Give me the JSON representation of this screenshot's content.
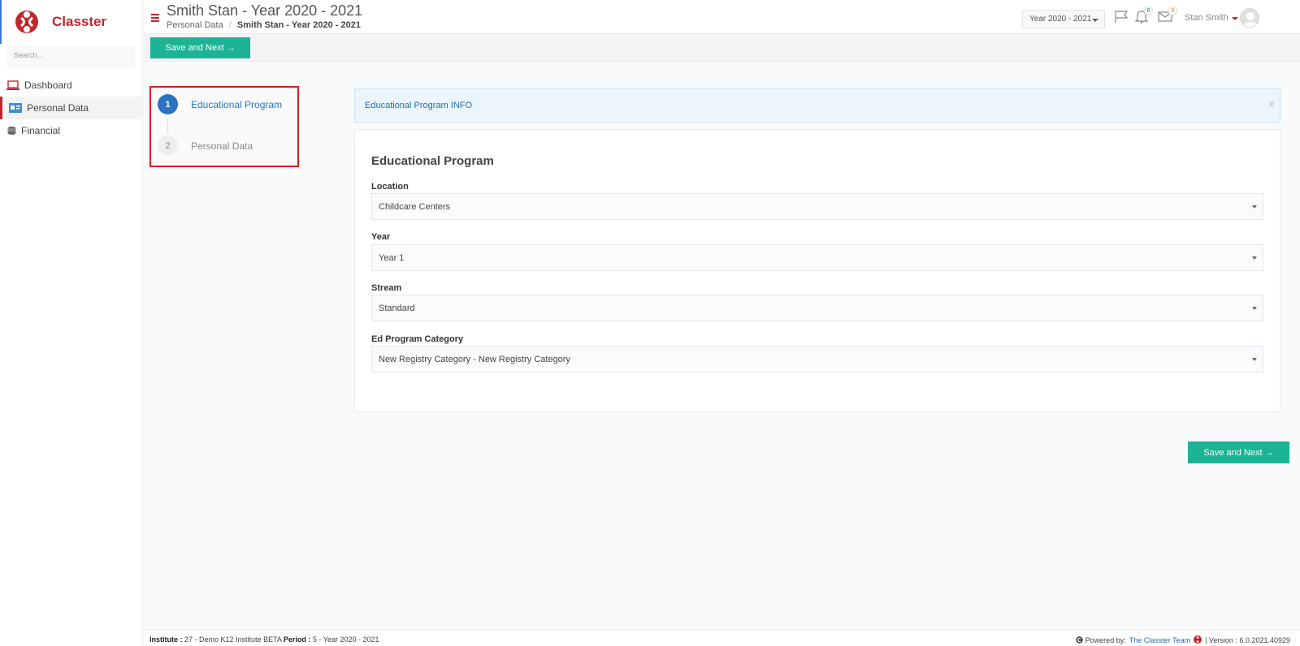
{
  "app": {
    "name": "Classter",
    "brand_color": "#c0272d",
    "accent_color": "#1bb394"
  },
  "sidebar": {
    "search_placeholder": "Search...",
    "items": [
      {
        "label": "Dashboard",
        "icon": "laptop-icon",
        "active": false
      },
      {
        "label": "Personal Data",
        "icon": "id-card-icon",
        "active": true
      },
      {
        "label": "Financial",
        "icon": "coins-icon",
        "active": false
      }
    ]
  },
  "header": {
    "title": "Smith Stan - Year 2020 - 2021",
    "breadcrumb": {
      "parent": "Personal Data",
      "separator": "/",
      "current": "Smith Stan - Year 2020 - 2021"
    },
    "year_selector": "Year 2020 - 2021",
    "notifications_count": "0",
    "messages_count": "0",
    "user_name": "Stan Smith"
  },
  "toolbar": {
    "save_next_label": "Save and Next →"
  },
  "stepper": {
    "steps": [
      {
        "number": "1",
        "label": "Educational Program",
        "active": true
      },
      {
        "number": "2",
        "label": "Personal Data",
        "active": false
      }
    ]
  },
  "info_alert": {
    "text": "Educational Program INFO",
    "close": "×"
  },
  "form": {
    "title": "Educational Program",
    "fields": [
      {
        "label": "Location",
        "value": "Childcare Centers"
      },
      {
        "label": "Year",
        "value": "Year 1"
      },
      {
        "label": "Stream",
        "value": "Standard"
      },
      {
        "label": "Ed Program Category",
        "value": "New Registry Category - New Registry Category"
      }
    ],
    "save_next_label": "Save and Next →"
  },
  "footer": {
    "institute_label": "Institute :",
    "institute_value": "27 - Demo K12 Institute BETA",
    "period_label": "Period :",
    "period_value": "5 - Year 2020 - 2021",
    "powered_by": "Powered by:",
    "team_link": "The Classter Team",
    "version": "| Version : 6.0.2021.40929"
  }
}
